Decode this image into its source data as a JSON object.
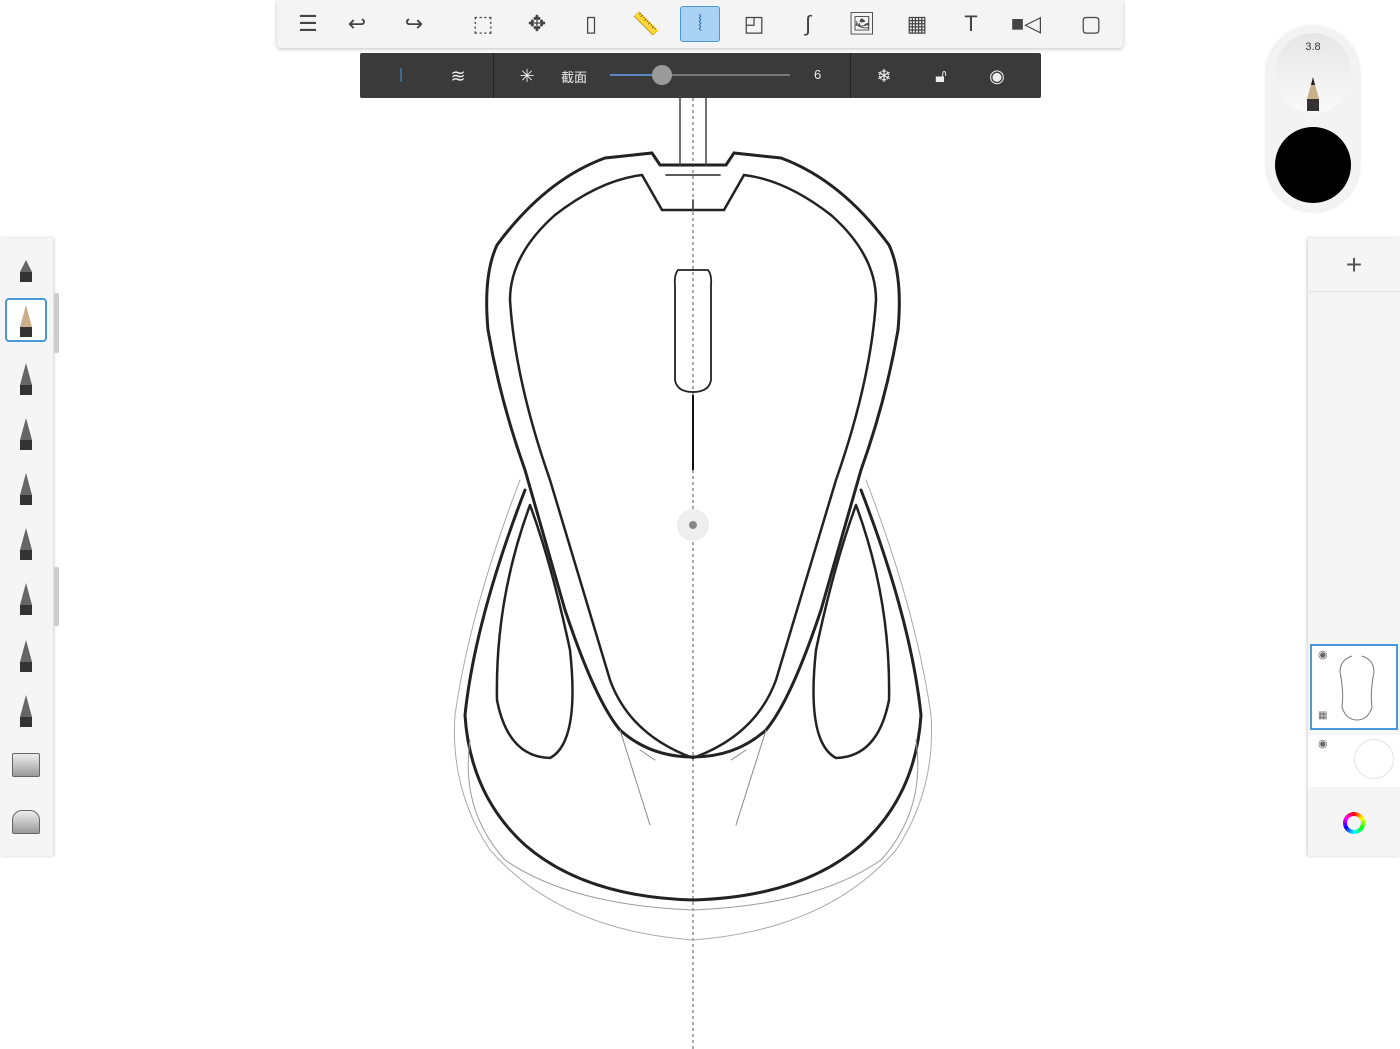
{
  "toolbar": {
    "items": [
      {
        "name": "layers-list",
        "icon": "list-icon",
        "glyph": "☰"
      },
      {
        "name": "undo",
        "icon": "undo-icon",
        "glyph": "↩"
      },
      {
        "name": "redo",
        "icon": "redo-icon",
        "glyph": "↪"
      },
      {
        "name": "selection",
        "icon": "select-icon",
        "glyph": "⬚"
      },
      {
        "name": "transform",
        "icon": "move-icon",
        "glyph": "✥"
      },
      {
        "name": "fill",
        "icon": "bucket-icon",
        "glyph": "▯"
      },
      {
        "name": "ruler",
        "icon": "ruler-icon",
        "glyph": "📏"
      },
      {
        "name": "symmetry",
        "icon": "symmetry-icon",
        "glyph": "⦚"
      },
      {
        "name": "shapes",
        "icon": "shapes-icon",
        "glyph": "◰"
      },
      {
        "name": "curve",
        "icon": "curve-icon",
        "glyph": "∫"
      },
      {
        "name": "add-image",
        "icon": "image-icon",
        "glyph": "🖼"
      },
      {
        "name": "perspective",
        "icon": "perspective-icon",
        "glyph": "▦"
      },
      {
        "name": "text",
        "icon": "text-icon",
        "glyph": "T"
      },
      {
        "name": "time-lapse",
        "icon": "video-icon",
        "glyph": "■◁"
      },
      {
        "name": "fullscreen",
        "icon": "fullscreen-icon",
        "glyph": "▢"
      }
    ],
    "active": "symmetry"
  },
  "symmetry": {
    "mode_label": "截面",
    "value": "6",
    "slider_fraction": 0.3
  },
  "brush_puck": {
    "size": "3.8",
    "color": "#000000"
  },
  "accent": "#4a98d8"
}
